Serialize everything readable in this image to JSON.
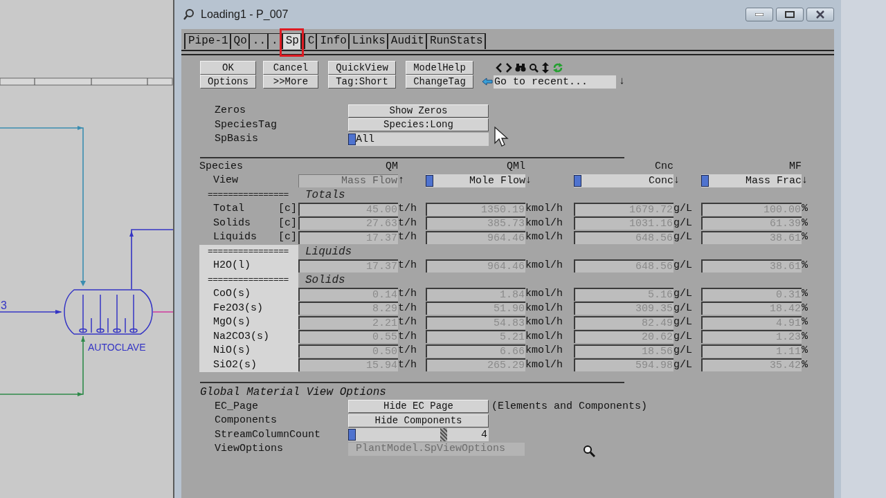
{
  "flowsheet": {
    "stream_label": "3",
    "unit_label": "AUTOCLAVE"
  },
  "window": {
    "title": "Loading1 - P_007"
  },
  "tabs": [
    {
      "label": "Pipe-1",
      "selected": false,
      "annotated": false
    },
    {
      "label": "Qo",
      "selected": false,
      "annotated": false
    },
    {
      "label": "..",
      "selected": false,
      "annotated": false
    },
    {
      "label": ".",
      "selected": false,
      "annotated": false
    },
    {
      "label": "Sp",
      "selected": true,
      "annotated": true
    },
    {
      "label": "C",
      "selected": false,
      "annotated": false
    },
    {
      "label": "Info",
      "selected": false,
      "annotated": false
    },
    {
      "label": "Links",
      "selected": false,
      "annotated": false
    },
    {
      "label": "Audit",
      "selected": false,
      "annotated": false
    },
    {
      "label": "RunStats",
      "selected": false,
      "annotated": false
    }
  ],
  "button_rows": [
    [
      "OK",
      "Cancel",
      "QuickView",
      "ModelHelp"
    ],
    [
      "Options",
      ">>More",
      "Tag:Short",
      "ChangeTag"
    ]
  ],
  "recent": {
    "value": "Go to recent...",
    "arrow": "↓"
  },
  "settings": [
    {
      "label": "Zeros",
      "kind": "button",
      "value": "Show Zeros"
    },
    {
      "label": "SpeciesTag",
      "kind": "button",
      "value": "Species:Long"
    },
    {
      "label": "SpBasis",
      "kind": "dropdown",
      "value": "All"
    }
  ],
  "species": {
    "label": "Species",
    "view_label": "View",
    "columns": [
      {
        "heading": "QM",
        "view": "Mass Flow",
        "arrow": "↑",
        "enabled": false
      },
      {
        "heading": "QMl",
        "view": "Mole Flow",
        "arrow": "↓",
        "enabled": true
      },
      {
        "heading": "Cnc",
        "view": "Conc",
        "arrow": "↓",
        "enabled": true
      },
      {
        "heading": "MF",
        "view": "Mass Frac",
        "arrow": "↓",
        "enabled": true
      }
    ],
    "sections": [
      {
        "rule": "================",
        "title": "Totals",
        "highlighted": false,
        "rows": [
          {
            "name": "Total",
            "tag": "[c]",
            "cells": [
              {
                "value": "45.00",
                "unit": "t/h"
              },
              {
                "value": "1350.19",
                "unit": "kmol/h"
              },
              {
                "value": "1679.72",
                "unit": "g/L"
              },
              {
                "value": "100.00",
                "unit": "%"
              }
            ]
          },
          {
            "name": "Solids",
            "tag": "[c]",
            "cells": [
              {
                "value": "27.63",
                "unit": "t/h"
              },
              {
                "value": "385.73",
                "unit": "kmol/h"
              },
              {
                "value": "1031.16",
                "unit": "g/L"
              },
              {
                "value": "61.39",
                "unit": "%"
              }
            ]
          },
          {
            "name": "Liquids",
            "tag": "[c]",
            "cells": [
              {
                "value": "17.37",
                "unit": "t/h"
              },
              {
                "value": "964.46",
                "unit": "kmol/h"
              },
              {
                "value": "648.56",
                "unit": "g/L"
              },
              {
                "value": "38.61",
                "unit": "%"
              }
            ]
          }
        ]
      },
      {
        "rule": "================",
        "title": "Liquids",
        "highlighted": true,
        "rows": [
          {
            "name": "H2O(l)",
            "cells": [
              {
                "value": "17.37",
                "unit": "t/h"
              },
              {
                "value": "964.46",
                "unit": "kmol/h"
              },
              {
                "value": "648.56",
                "unit": "g/L"
              },
              {
                "value": "38.61",
                "unit": "%"
              }
            ]
          }
        ]
      },
      {
        "rule": "================",
        "title": "Solids",
        "highlighted": true,
        "rows": [
          {
            "name": "CoO(s)",
            "cells": [
              {
                "value": "0.14",
                "unit": "t/h"
              },
              {
                "value": "1.84",
                "unit": "kmol/h"
              },
              {
                "value": "5.16",
                "unit": "g/L"
              },
              {
                "value": "0.31",
                "unit": "%"
              }
            ]
          },
          {
            "name": "Fe2O3(s)",
            "cells": [
              {
                "value": "8.29",
                "unit": "t/h"
              },
              {
                "value": "51.90",
                "unit": "kmol/h"
              },
              {
                "value": "309.35",
                "unit": "g/L"
              },
              {
                "value": "18.42",
                "unit": "%"
              }
            ]
          },
          {
            "name": "MgO(s)",
            "cells": [
              {
                "value": "2.21",
                "unit": "t/h"
              },
              {
                "value": "54.83",
                "unit": "kmol/h"
              },
              {
                "value": "82.49",
                "unit": "g/L"
              },
              {
                "value": "4.91",
                "unit": "%"
              }
            ]
          },
          {
            "name": "Na2CO3(s)",
            "cells": [
              {
                "value": "0.55",
                "unit": "t/h"
              },
              {
                "value": "5.21",
                "unit": "kmol/h"
              },
              {
                "value": "20.62",
                "unit": "g/L"
              },
              {
                "value": "1.23",
                "unit": "%"
              }
            ]
          },
          {
            "name": "NiO(s)",
            "cells": [
              {
                "value": "0.50",
                "unit": "t/h"
              },
              {
                "value": "6.66",
                "unit": "kmol/h"
              },
              {
                "value": "18.56",
                "unit": "g/L"
              },
              {
                "value": "1.11",
                "unit": "%"
              }
            ]
          },
          {
            "name": "SiO2(s)",
            "cells": [
              {
                "value": "15.94",
                "unit": "t/h"
              },
              {
                "value": "265.29",
                "unit": "kmol/h"
              },
              {
                "value": "594.98",
                "unit": "g/L"
              },
              {
                "value": "35.42",
                "unit": "%"
              }
            ]
          }
        ]
      }
    ]
  },
  "global_options": {
    "title": "Global Material View Options",
    "items": [
      {
        "label": "EC_Page",
        "kind": "button",
        "value": "Hide EC Page",
        "note": "(Elements and Components)"
      },
      {
        "label": "Components",
        "kind": "button",
        "value": "Hide Components"
      },
      {
        "label": "StreamColumnCount",
        "kind": "slider",
        "value": "4",
        "level": 0.68
      },
      {
        "label": "ViewOptions",
        "kind": "readonly",
        "value": "PlantModel.SpViewOptions"
      }
    ]
  }
}
